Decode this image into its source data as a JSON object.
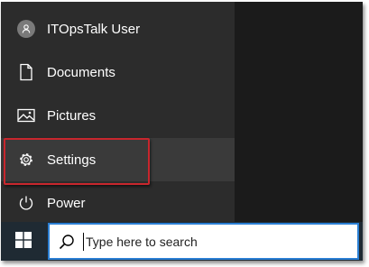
{
  "start_menu": {
    "user": {
      "label": "ITOpsTalk User",
      "icon": "user-avatar-icon"
    },
    "items": [
      {
        "label": "Documents",
        "icon": "document-icon"
      },
      {
        "label": "Pictures",
        "icon": "pictures-icon"
      },
      {
        "label": "Settings",
        "icon": "gear-icon",
        "highlighted": true
      },
      {
        "label": "Power",
        "icon": "power-icon"
      }
    ]
  },
  "taskbar": {
    "start_icon": "windows-logo-icon",
    "search": {
      "placeholder": "Type here to search",
      "icon": "search-icon"
    }
  },
  "colors": {
    "menu_background": "#2c2c2c",
    "desktop_background": "#1b1b1b",
    "hover_background": "#3a3a3a",
    "highlight_border": "#c8262d",
    "search_border": "#2b7fd4",
    "taskbar_background": "#1f2a33"
  }
}
